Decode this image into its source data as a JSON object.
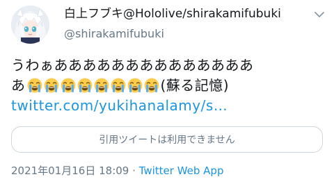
{
  "author": {
    "display_name": "白上フブキ@Hololive/shirakamifubuki",
    "handle": "@shirakamifubuki"
  },
  "tweet": {
    "line1": "うわぁああああああああああああああ",
    "line2_prefix": "あ",
    "emoji_name": "loudly-crying-face",
    "emoji_count": 8,
    "line2_suffix": "(蘇る記憶)",
    "link": "twitter.com/yukihanalamy/s…"
  },
  "quote": {
    "unavailable_text": "引用ツイートは利用できません"
  },
  "meta": {
    "timestamp": "2021年01月16日 18:09",
    "separator": " · ",
    "source_app": "Twitter Web App"
  },
  "colors": {
    "link": "#1b95e0",
    "secondary_text": "#657786",
    "border": "#ccd6dd",
    "emoji_face": "#ffcc4d"
  }
}
